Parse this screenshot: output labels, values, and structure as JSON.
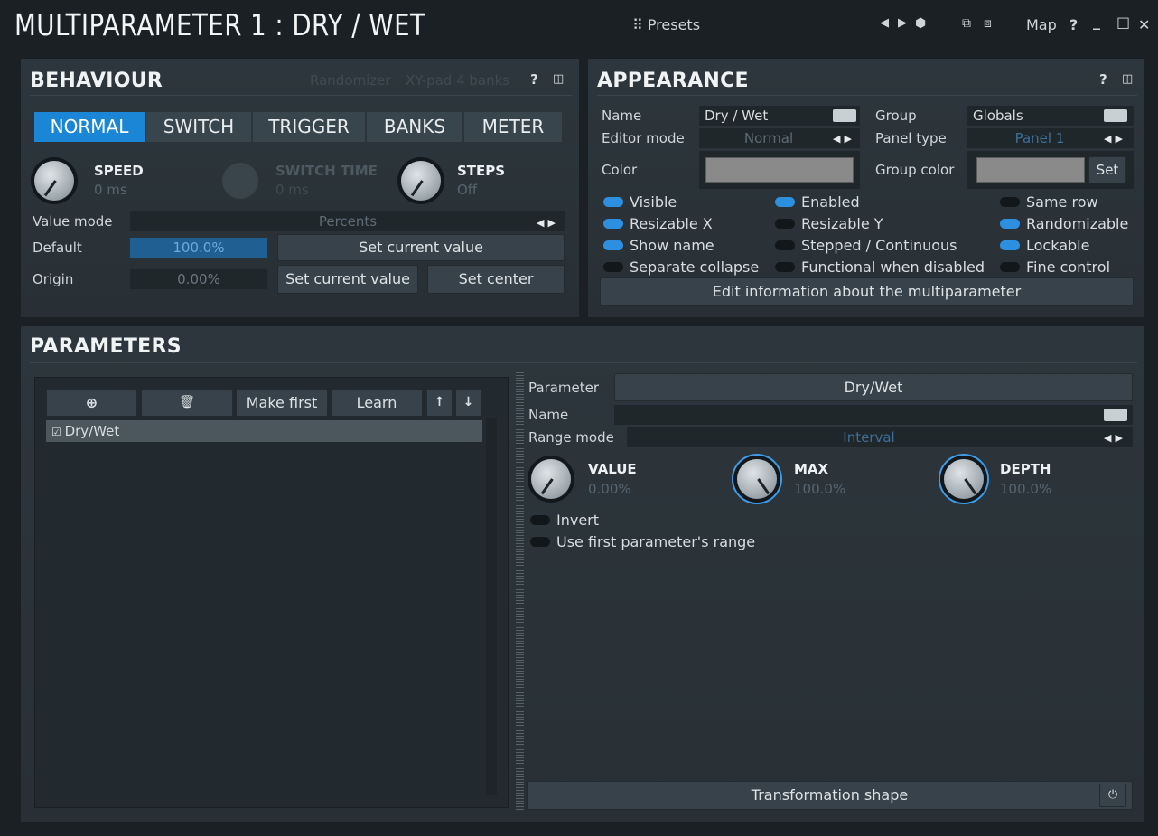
{
  "title": "MULTIPARAMETER 1 : DRY / WET",
  "topbar": {
    "presets": "Presets",
    "map": "Map",
    "help": "?",
    "minimize": "_",
    "maximize": "□",
    "close": "✕"
  },
  "behaviour": {
    "title": "BEHAVIOUR",
    "randomizer": "Randomizer",
    "xypad": "XY-pad 4 banks",
    "help": "?",
    "tabs": [
      "NORMAL",
      "SWITCH",
      "TRIGGER",
      "BANKS",
      "METER"
    ],
    "active_tab": "NORMAL",
    "speed": {
      "label": "SPEED",
      "value": "0 ms"
    },
    "switch_time": {
      "label": "SWITCH TIME",
      "value": "0 ms"
    },
    "steps": {
      "label": "STEPS",
      "value": "Off"
    },
    "value_mode_label": "Value mode",
    "value_mode": "Percents",
    "default_label": "Default",
    "default_value": "100.0%",
    "default_fill": 1.0,
    "set_current_1": "Set current value",
    "origin_label": "Origin",
    "origin_value": "0.00%",
    "set_current_2": "Set current value",
    "set_center": "Set center"
  },
  "appearance": {
    "title": "APPEARANCE",
    "help": "?",
    "name_label": "Name",
    "name_value": "Dry / Wet",
    "group_label": "Group",
    "group_value": "Globals",
    "editor_mode_label": "Editor mode",
    "editor_mode": "Normal",
    "panel_type_label": "Panel type",
    "panel_type": "Panel 1",
    "color_label": "Color",
    "group_color_label": "Group color",
    "set_label": "Set",
    "swatch_color": "#8a8a8a",
    "toggles": [
      {
        "label": "Visible",
        "on": true
      },
      {
        "label": "Enabled",
        "on": true
      },
      {
        "label": "Same row",
        "on": false
      },
      {
        "label": "Resizable X",
        "on": true
      },
      {
        "label": "Resizable Y",
        "on": false
      },
      {
        "label": "Randomizable",
        "on": true
      },
      {
        "label": "Show name",
        "on": true
      },
      {
        "label": "Stepped / Continuous",
        "on": false
      },
      {
        "label": "Lockable",
        "on": true
      },
      {
        "label": "Separate collapse",
        "on": false
      },
      {
        "label": "Functional when disabled",
        "on": false
      },
      {
        "label": "Fine control",
        "on": false
      }
    ],
    "edit_info": "Edit information about the multiparameter"
  },
  "parameters": {
    "title": "PARAMETERS",
    "make_first": "Make first",
    "learn": "Learn",
    "list": [
      "Dry/Wet"
    ],
    "parameter_label": "Parameter",
    "parameter_value": "Dry/Wet",
    "name_label": "Name",
    "range_mode_label": "Range mode",
    "range_mode": "Interval",
    "value": {
      "label": "VALUE",
      "value": "0.00%"
    },
    "max": {
      "label": "MAX",
      "value": "100.0%"
    },
    "depth": {
      "label": "DEPTH",
      "value": "100.0%"
    },
    "invert": "Invert",
    "use_first": "Use first parameter's range",
    "transformation": "Transformation shape"
  },
  "colors": {
    "accent": "#1b86d6",
    "panel": "#2d363c"
  }
}
